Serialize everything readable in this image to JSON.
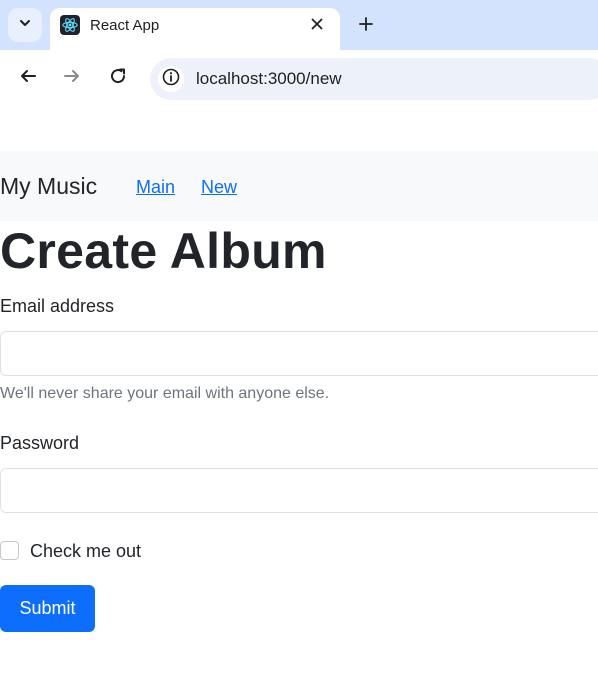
{
  "browser": {
    "tab": {
      "title": "React App"
    },
    "address_bar": {
      "url": "localhost:3000/new"
    },
    "icons": [
      "tab-search-icon",
      "react-favicon-icon",
      "close-icon",
      "plus-icon",
      "back-arrow-icon",
      "forward-arrow-icon",
      "reload-icon",
      "site-info-icon"
    ]
  },
  "navbar": {
    "brand": "My Music",
    "links": [
      {
        "label": "Main"
      },
      {
        "label": "New"
      }
    ]
  },
  "page": {
    "title": "Create Album",
    "form": {
      "email": {
        "label": "Email address",
        "value": "",
        "help": "We'll never share your email with anyone else."
      },
      "password": {
        "label": "Password",
        "value": ""
      },
      "checkbox": {
        "label": "Check me out",
        "checked": false
      },
      "submit_label": "Submit"
    }
  },
  "colors": {
    "primary": "#0d6efd",
    "navbar_bg": "#f8f9fa",
    "tabstrip_bg": "#d3e3fd"
  }
}
